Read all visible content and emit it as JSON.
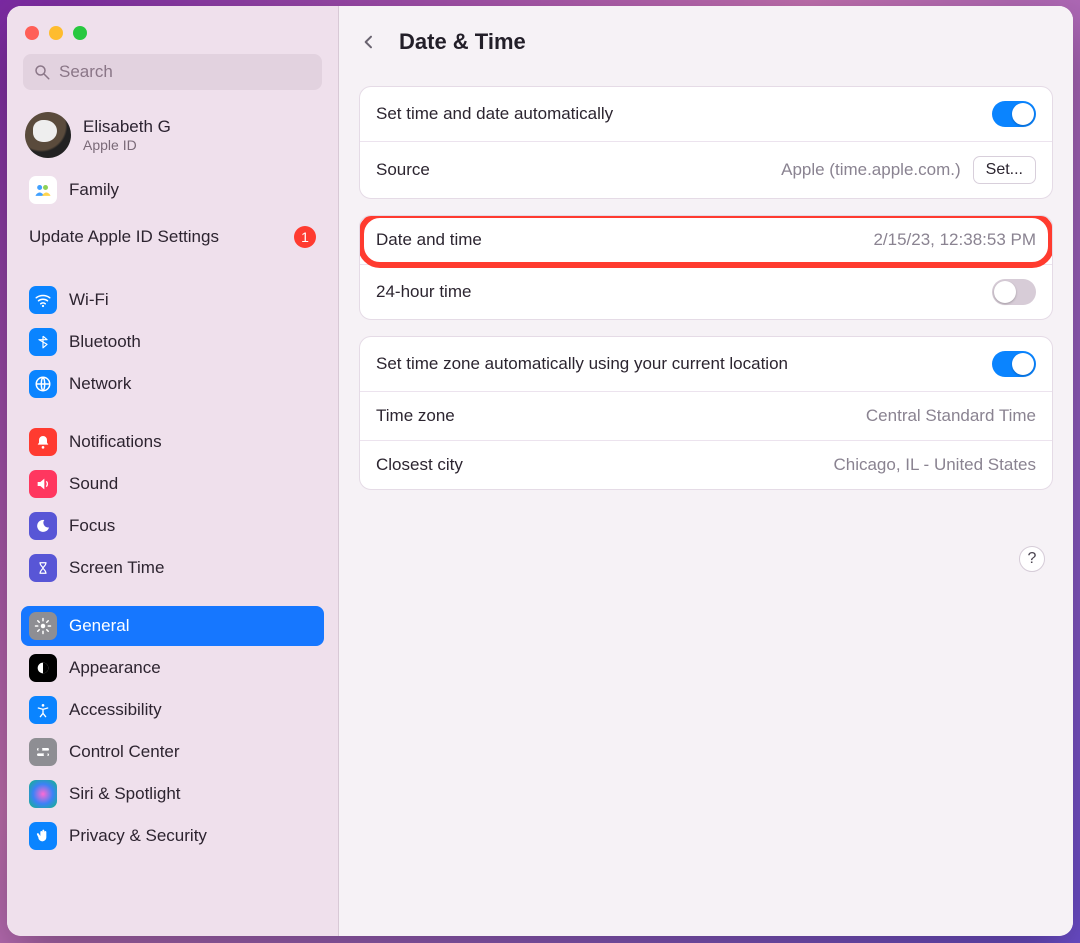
{
  "window": {
    "title": "Date & Time"
  },
  "search": {
    "placeholder": "Search"
  },
  "account": {
    "name": "Elisabeth G",
    "sub": "Apple ID"
  },
  "sidebar": {
    "family": {
      "label": "Family"
    },
    "update": {
      "label": "Update Apple ID Settings",
      "badge": "1"
    },
    "wifi": {
      "label": "Wi-Fi"
    },
    "bluetooth": {
      "label": "Bluetooth"
    },
    "network": {
      "label": "Network"
    },
    "notifications": {
      "label": "Notifications"
    },
    "sound": {
      "label": "Sound"
    },
    "focus": {
      "label": "Focus"
    },
    "screentime": {
      "label": "Screen Time"
    },
    "general": {
      "label": "General"
    },
    "appearance": {
      "label": "Appearance"
    },
    "accessibility": {
      "label": "Accessibility"
    },
    "controlcenter": {
      "label": "Control Center"
    },
    "siri": {
      "label": "Siri & Spotlight"
    },
    "privacy": {
      "label": "Privacy & Security"
    }
  },
  "rows": {
    "auto_time": {
      "label": "Set time and date automatically",
      "on": true
    },
    "source": {
      "label": "Source",
      "value": "Apple (time.apple.com.)",
      "button": "Set..."
    },
    "date_time": {
      "label": "Date and time",
      "value": "2/15/23, 12:38:53 PM"
    },
    "h24": {
      "label": "24-hour time",
      "on": false
    },
    "auto_zone": {
      "label": "Set time zone automatically using your current location",
      "on": true
    },
    "zone": {
      "label": "Time zone",
      "value": "Central Standard Time"
    },
    "city": {
      "label": "Closest city",
      "value": "Chicago, IL - United States"
    }
  },
  "help": {
    "label": "?"
  }
}
